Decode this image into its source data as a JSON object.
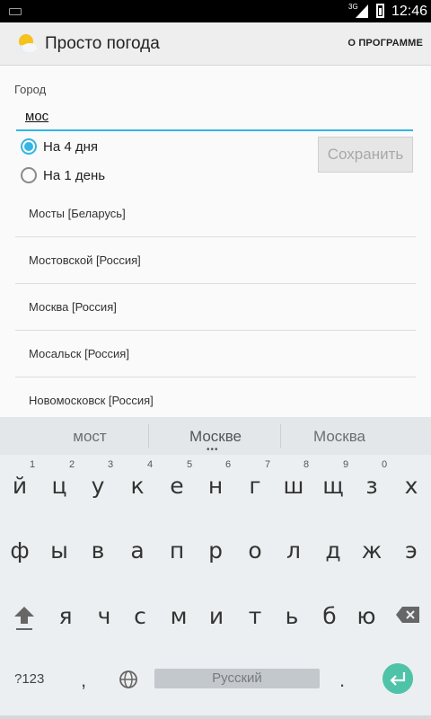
{
  "status_bar": {
    "network": "3G",
    "time": "12:46"
  },
  "action_bar": {
    "app_title": "Просто погода",
    "about_label": "О ПРОГРАММЕ",
    "app_icon": "sun-cloud-icon"
  },
  "form": {
    "city_label": "Город",
    "city_value": "мос",
    "radio_4days": "На 4 дня",
    "radio_1day": "На 1 день",
    "selected": "На 4 дня",
    "save_label": "Сохранить"
  },
  "suggestions": [
    "Мосты [Беларусь]",
    "Мостовской [Россия]",
    "Москва [Россия]",
    "Мосальск [Россия]",
    "Новомосковск [Россия]"
  ],
  "keyboard": {
    "word_suggestions": [
      "мост",
      "Москве",
      "Москва"
    ],
    "row1": [
      "й",
      "ц",
      "у",
      "к",
      "е",
      "н",
      "г",
      "ш",
      "щ",
      "з",
      "х"
    ],
    "row1_hints": [
      "1",
      "2",
      "3",
      "4",
      "5",
      "6",
      "7",
      "8",
      "9",
      "0"
    ],
    "row2": [
      "ф",
      "ы",
      "в",
      "а",
      "п",
      "р",
      "о",
      "л",
      "д",
      "ж",
      "э"
    ],
    "row3": [
      "я",
      "ч",
      "с",
      "м",
      "и",
      "т",
      "ь",
      "б",
      "ю"
    ],
    "symbols_label": "?123",
    "comma": ",",
    "space_label": "Русский",
    "period": ".",
    "accent_color": "#4fc3a8"
  },
  "colors": {
    "accent": "#33b5e5"
  }
}
